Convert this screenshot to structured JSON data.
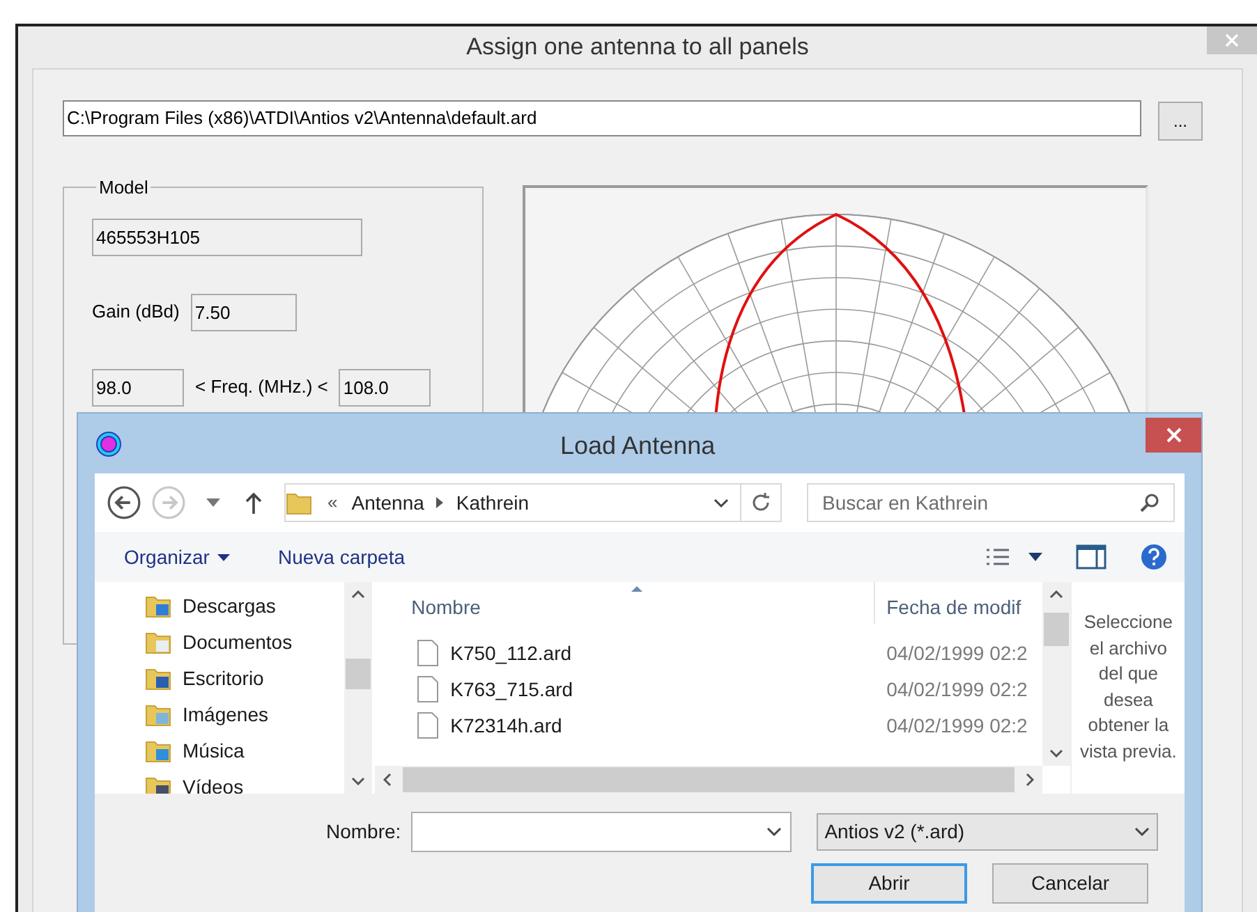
{
  "main_window": {
    "title": "Assign one antenna to all panels",
    "file_path": "C:\\Program Files (x86)\\ATDI\\Antios v2\\Antenna\\default.ard",
    "browse_button": "...",
    "model_group": {
      "label": "Model",
      "model": "465553H105",
      "gain_label": "Gain (dBd)",
      "gain": "7.50",
      "freq_min": "98.0",
      "freq_label": "< Freq. (MHz.) <",
      "freq_max": "108.0"
    }
  },
  "load_dialog": {
    "title": "Load Antenna",
    "nav_buttons": [
      {
        "kind": "back",
        "disabled": false
      },
      {
        "kind": "forward",
        "disabled": true
      }
    ],
    "breadcrumb_prefix": "«",
    "breadcrumb": [
      "Antenna",
      "Kathrein"
    ],
    "search_placeholder": "Buscar en Kathrein",
    "toolbar": [
      {
        "label": "Organizar",
        "menu": true
      },
      {
        "label": "Nueva carpeta",
        "menu": false
      }
    ],
    "nav_items": [
      {
        "label": "Descargas",
        "kind": "downloads"
      },
      {
        "label": "Documentos",
        "kind": "documents"
      },
      {
        "label": "Escritorio",
        "kind": "desktop"
      },
      {
        "label": "Imágenes",
        "kind": "pictures"
      },
      {
        "label": "Música",
        "kind": "music"
      },
      {
        "label": "Vídeos",
        "kind": "videos"
      }
    ],
    "columns": [
      "Nombre",
      "Fecha de modif"
    ],
    "files": [
      {
        "name": "K750_112.ard",
        "date": "04/02/1999 02:2"
      },
      {
        "name": "K763_715.ard",
        "date": "04/02/1999 02:2"
      },
      {
        "name": "K72314h.ard",
        "date": "04/02/1999 02:2"
      }
    ],
    "preview_text": "Seleccione el archivo del que desea obtener la vista previa.",
    "filename_label": "Nombre:",
    "filter": "Antios v2 (*.ard)",
    "buttons": [
      {
        "label": "Abrir",
        "default": true
      },
      {
        "label": "Cancelar",
        "default": false
      }
    ]
  }
}
